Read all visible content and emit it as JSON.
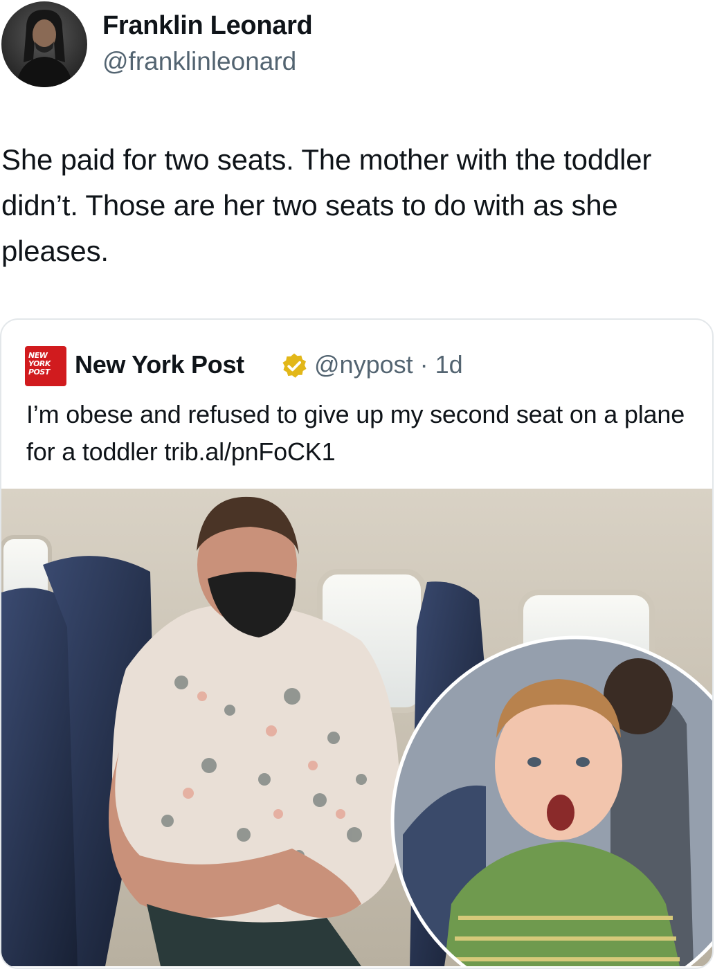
{
  "tweet": {
    "author_name": "Franklin Leonard",
    "author_handle": "@franklinleonard",
    "text": "She paid for two seats. The mother with the toddler didn’t. Those are her two seats to do with as she pleases."
  },
  "quoted_tweet": {
    "author_name": "New York Post",
    "logo_lines": [
      "NEW",
      "YORK",
      "POST"
    ],
    "author_handle": "@nypost",
    "separator": "·",
    "age": "1d",
    "text": "I’m obese and refused to give up my second seat on a plane for a toddler trib.al/pnFoCK1",
    "verified_color": "#e2b719",
    "logo_color": "#d11b1e"
  },
  "icons": {
    "verified": "verified-badge-icon",
    "logo": "new-york-post-logo"
  }
}
